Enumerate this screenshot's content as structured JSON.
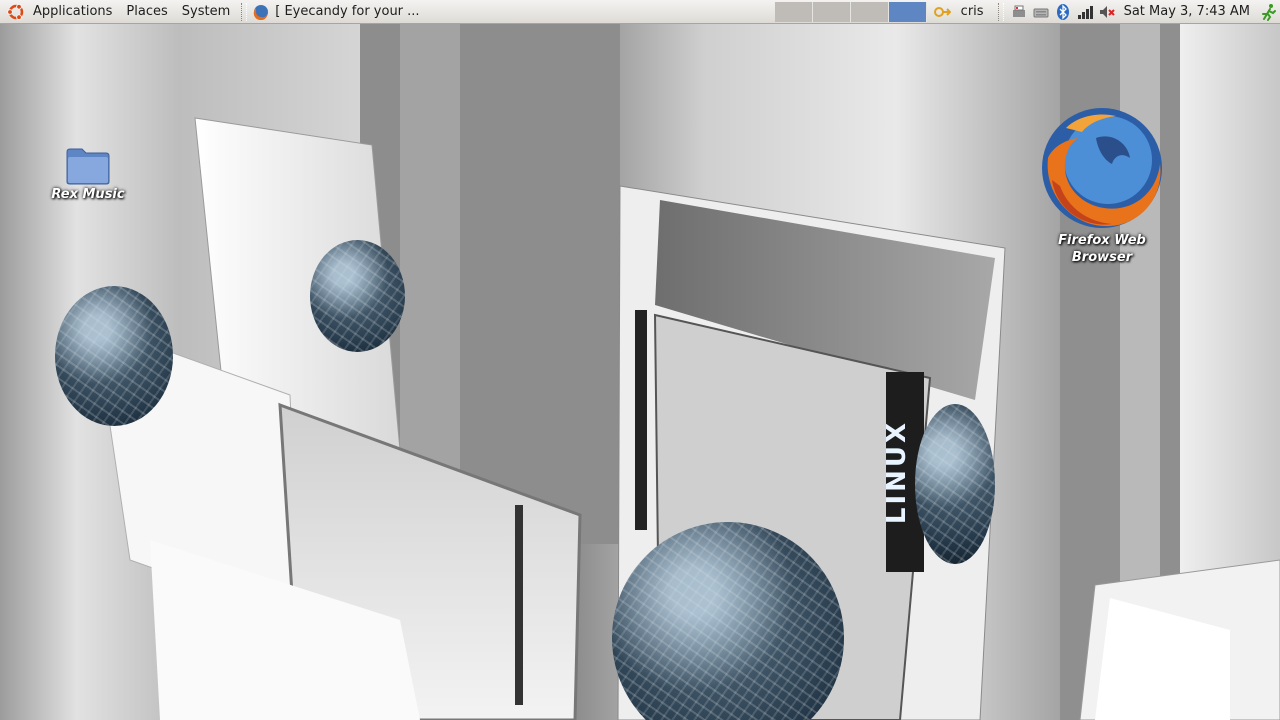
{
  "panel": {
    "menus": {
      "applications": "Applications",
      "places": "Places",
      "system": "System"
    },
    "task_title": "[ Eyecandy for your ...",
    "workspaces": [
      {
        "active": false
      },
      {
        "active": false
      },
      {
        "active": false
      },
      {
        "active": true
      }
    ],
    "user": "cris",
    "clock": "Sat May  3,  7:43 AM"
  },
  "desktop": {
    "wallpaper_text": "LINUX",
    "icons": {
      "folder": {
        "label": "Rex Music"
      },
      "firefox": {
        "label_line1": "Firefox Web",
        "label_line2": "Browser"
      }
    }
  },
  "colors": {
    "panel_top": "#f4f3f1",
    "panel_bottom": "#dedbd6",
    "active_workspace": "#5d86c3",
    "folder_blue": "#7a9fd6",
    "sphere": "#2f4556"
  }
}
